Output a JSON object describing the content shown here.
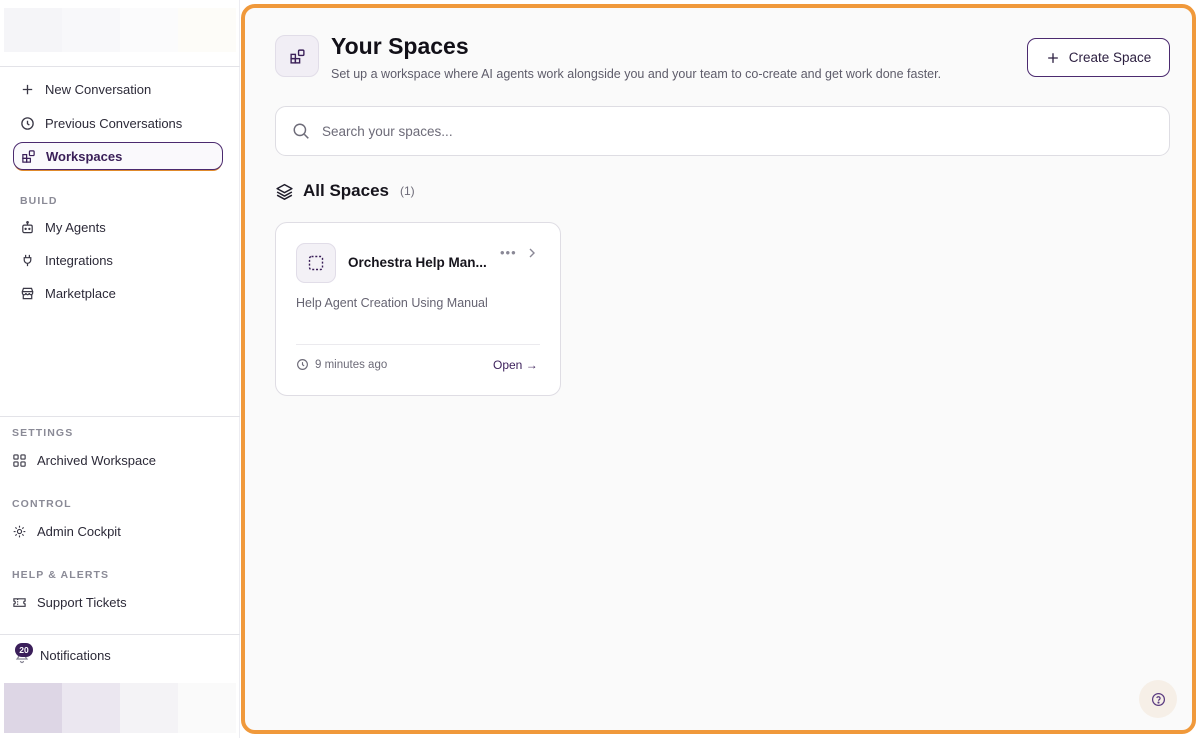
{
  "sidebar": {
    "nav": {
      "new_conversation": "New Conversation",
      "previous_conversations": "Previous Conversations",
      "workspaces": "Workspaces"
    },
    "build_label": "BUILD",
    "build": {
      "my_agents": "My Agents",
      "integrations": "Integrations",
      "marketplace": "Marketplace"
    },
    "settings_label": "SETTINGS",
    "archived_workspace": "Archived Workspace",
    "control_label": "CONTROL",
    "admin_cockpit": "Admin Cockpit",
    "help_label": "HELP & ALERTS",
    "support_tickets": "Support Tickets",
    "notifications": {
      "label": "Notifications",
      "count": "20"
    }
  },
  "header": {
    "title": "Your Spaces",
    "subtitle": "Set up a workspace where AI agents work alongside you and your team to co-create and get work done faster.",
    "create_button": "Create Space"
  },
  "search": {
    "placeholder": "Search your spaces..."
  },
  "all_spaces": {
    "title": "All Spaces",
    "count": "(1)"
  },
  "spaces": [
    {
      "title": "Orchestra Help Man...",
      "description": "Help Agent Creation Using Manual",
      "time": "9 minutes ago",
      "open_label": "Open →"
    }
  ],
  "colors": {
    "accent": "#3b1f5a",
    "highlight_border": "#f0993b"
  }
}
